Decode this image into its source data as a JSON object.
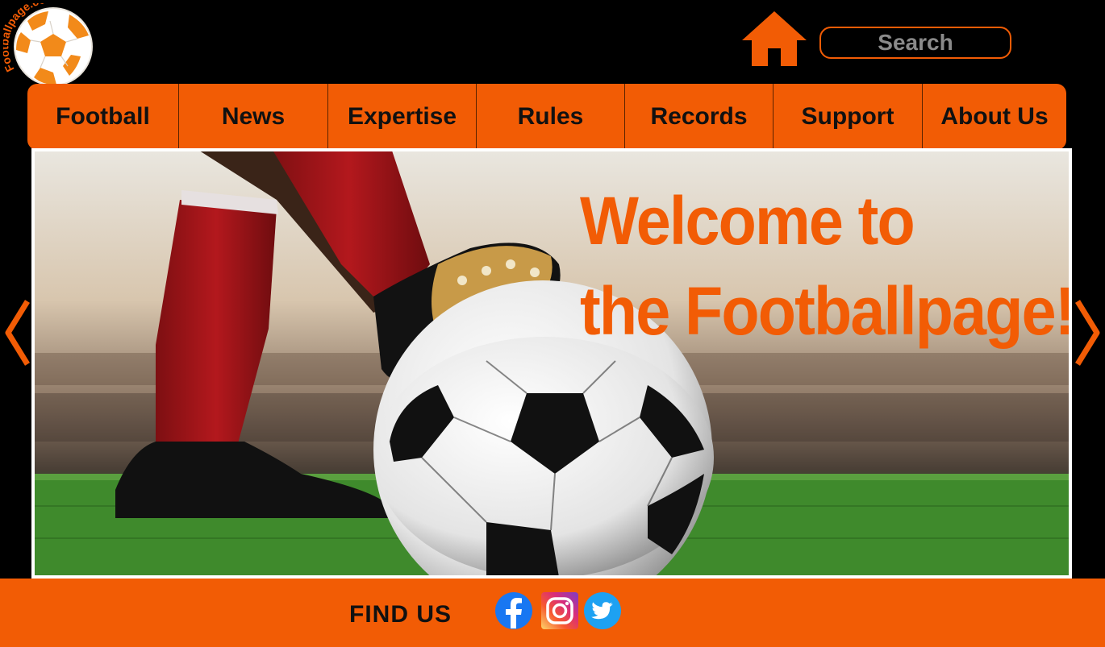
{
  "logo": {
    "text": "Footballpage.com",
    "icon": "soccer-ball-logo-icon"
  },
  "header": {
    "home_icon": "home-icon",
    "search_placeholder": "Search"
  },
  "nav": {
    "items": [
      {
        "label": "Football"
      },
      {
        "label": "News"
      },
      {
        "label": "Expertise"
      },
      {
        "label": "Rules"
      },
      {
        "label": "Records"
      },
      {
        "label": "Support"
      },
      {
        "label": "About Us"
      }
    ]
  },
  "hero": {
    "title_line1": "Welcome to",
    "title_line2": "the Footballpage!",
    "image": "footballer-foot-on-ball-stadium"
  },
  "carousel": {
    "prev_icon": "chevron-left-icon",
    "next_icon": "chevron-right-icon"
  },
  "footer": {
    "find_us_label": "FIND US",
    "social": [
      "facebook-icon",
      "instagram-icon",
      "twitter-icon"
    ]
  },
  "colors": {
    "accent": "#f25c05",
    "background": "#000000",
    "text_dark": "#111111",
    "search_text": "#8a8a8a"
  }
}
